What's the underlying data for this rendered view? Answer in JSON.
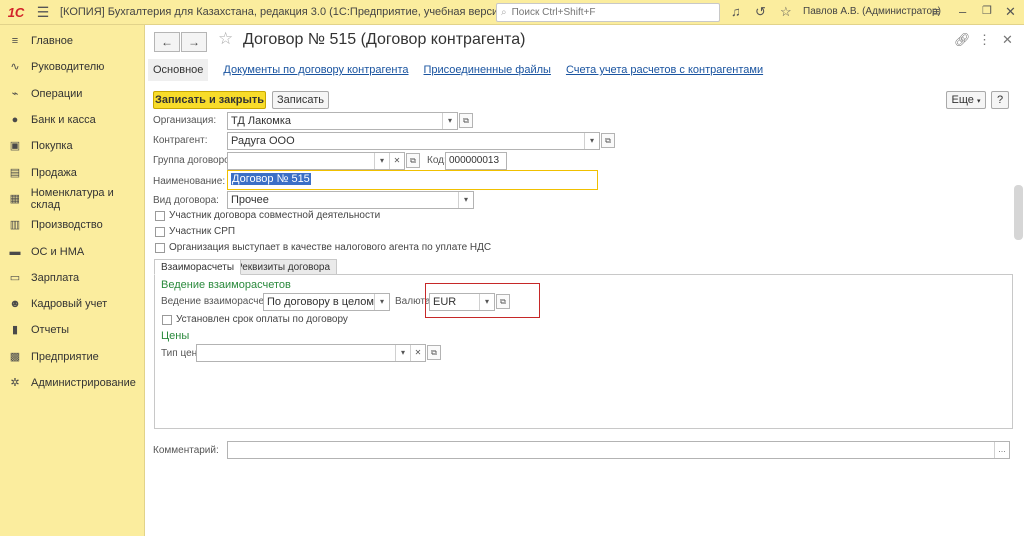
{
  "app": {
    "logo": "1С",
    "title": "[КОПИЯ] Бухгалтерия для Казахстана, редакция 3.0  (1С:Предприятие, учебная версия)",
    "search_placeholder": "Поиск Ctrl+Shift+F",
    "user": "Павлов А.В. (Администратор)"
  },
  "sidebar": {
    "items": [
      {
        "label": "Главное",
        "icon": "≡"
      },
      {
        "label": "Руководителю",
        "icon": "∿"
      },
      {
        "label": "Операции",
        "icon": "⌁"
      },
      {
        "label": "Банк и касса",
        "icon": "●"
      },
      {
        "label": "Покупка",
        "icon": "▣"
      },
      {
        "label": "Продажа",
        "icon": "▤"
      },
      {
        "label": "Номенклатура и склад",
        "icon": "▦"
      },
      {
        "label": "Производство",
        "icon": "▥"
      },
      {
        "label": "ОС и НМА",
        "icon": "▬"
      },
      {
        "label": "Зарплата",
        "icon": "▭"
      },
      {
        "label": "Кадровый учет",
        "icon": "☻"
      },
      {
        "label": "Отчеты",
        "icon": "▮"
      },
      {
        "label": "Предприятие",
        "icon": "▩"
      },
      {
        "label": "Администрирование",
        "icon": "✲"
      }
    ]
  },
  "form": {
    "title": "Договор № 515 (Договор контрагента)",
    "tabs": [
      {
        "label": "Основное"
      },
      {
        "label": "Документы по договору контрагента"
      },
      {
        "label": "Присоединенные файлы"
      },
      {
        "label": "Счета учета расчетов с контрагентами"
      }
    ],
    "buttons": {
      "save_close": "Записать и закрыть",
      "save": "Записать",
      "more": "Еще",
      "help": "?"
    },
    "fields": {
      "organization_label": "Организация:",
      "organization_value": "ТД Лакомка",
      "counterparty_label": "Контрагент:",
      "counterparty_value": "Радуга ООО",
      "group_label": "Группа договоров:",
      "group_value": "",
      "code_label": "Код:",
      "code_value": "000000013",
      "name_label": "Наименование:",
      "name_value": "Договор № 515",
      "type_label": "Вид договора:",
      "type_value": "Прочее",
      "comment_label": "Комментарий:",
      "comment_value": ""
    },
    "checkboxes": [
      {
        "label": "Участник договора совместной деятельности",
        "checked": false
      },
      {
        "label": "Участник СРП",
        "checked": false
      },
      {
        "label": "Организация выступает в качестве налогового агента по уплате НДС",
        "checked": false
      }
    ],
    "inner_tabs": [
      {
        "label": "Взаиморасчеты"
      },
      {
        "label": "Реквизиты договора"
      }
    ],
    "settlements": {
      "group_title": "Ведение взаиморасчетов",
      "mode_label": "Ведение взаиморасчетов:",
      "mode_value": "По договору в целом",
      "currency_label": "Валюта:",
      "currency_value": "EUR",
      "term_checkbox": "Установлен срок оплаты по договору"
    },
    "prices": {
      "group_title": "Цены",
      "price_type_label": "Тип цен:",
      "price_type_value": ""
    }
  }
}
